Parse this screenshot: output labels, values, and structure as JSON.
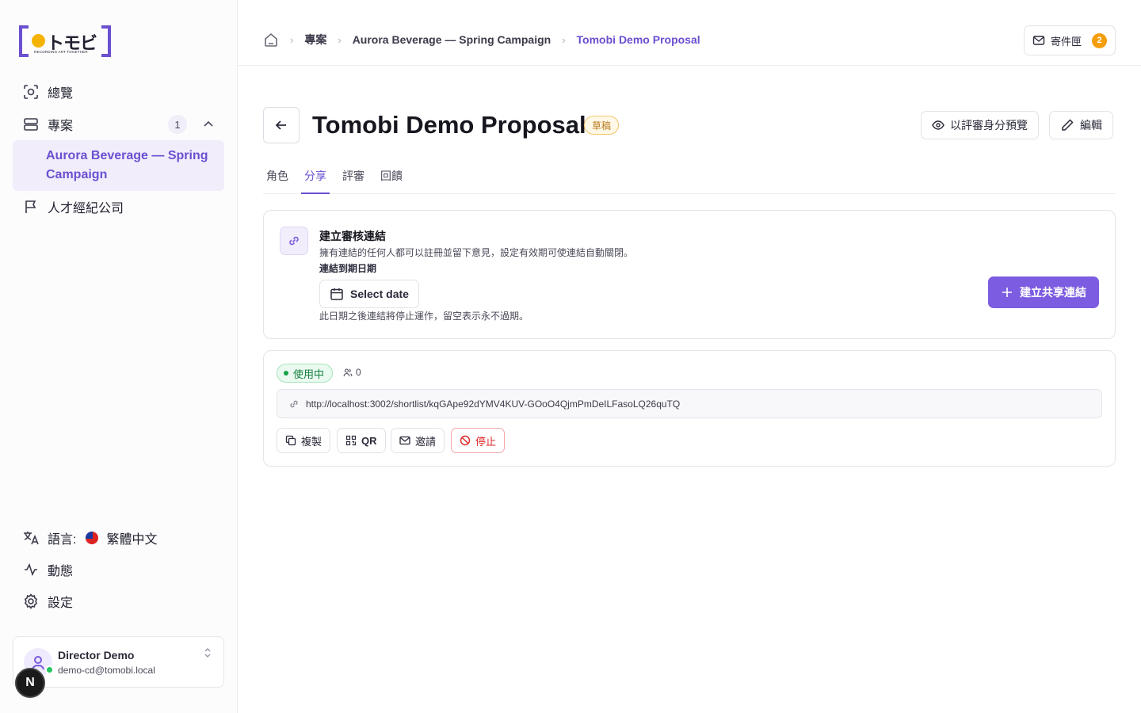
{
  "logo": {
    "kana": "トモビ",
    "tagline": "RECORDING ART TOGETHER"
  },
  "sidebar": {
    "items": [
      {
        "label": "總覽",
        "icon": "overview-icon"
      },
      {
        "label": "專案",
        "icon": "projects-icon",
        "badge": "1"
      },
      {
        "label": "人才經紀公司",
        "icon": "flag-icon"
      }
    ],
    "sub_item": "Aurora Beverage — Spring Campaign",
    "bottom": [
      {
        "label": "語言:",
        "value": "繁體中文",
        "icon": "translate-icon"
      },
      {
        "label": "動態",
        "icon": "activity-icon"
      },
      {
        "label": "設定",
        "icon": "gear-icon"
      }
    ],
    "user": {
      "name": "Director Demo",
      "email": "demo-cd@tomobi.local"
    },
    "dev_badge": "N"
  },
  "header": {
    "breadcrumbs": [
      "專案",
      "Aurora Beverage — Spring Campaign",
      "Tomobi Demo Proposal"
    ],
    "inbox_label": "寄件匣",
    "inbox_count": "2"
  },
  "page": {
    "title": "Tomobi Demo Proposal",
    "status": "草稿",
    "preview_label": "以評審身分預覽",
    "edit_label": "編輯",
    "tabs": [
      "角色",
      "分享",
      "評審",
      "回饋"
    ],
    "active_tab": "分享"
  },
  "create_card": {
    "title": "建立審核連結",
    "description": "擁有連結的任何人都可以註冊並留下意見，設定有效期可使連結自動關閉。",
    "expiry_label": "連結到期日期",
    "date_placeholder": "Select date",
    "hint": "此日期之後連結將停止運作，留空表示永不過期。",
    "create_label": "建立共享連結"
  },
  "link_card": {
    "status": "使用中",
    "viewer_count": "0",
    "url": "http://localhost:3002/shortlist/kqGApe92dYMV4KUV-GOoO4QjmPmDeILFasoLQ26quTQ",
    "actions": {
      "copy": "複製",
      "qr": "QR",
      "invite": "邀請",
      "stop": "停止"
    }
  },
  "colors": {
    "accent": "#6b4fd0",
    "button": "#7c5ce0",
    "warning": "#f59e0b",
    "success": "#16a34a",
    "danger": "#dc2626"
  }
}
